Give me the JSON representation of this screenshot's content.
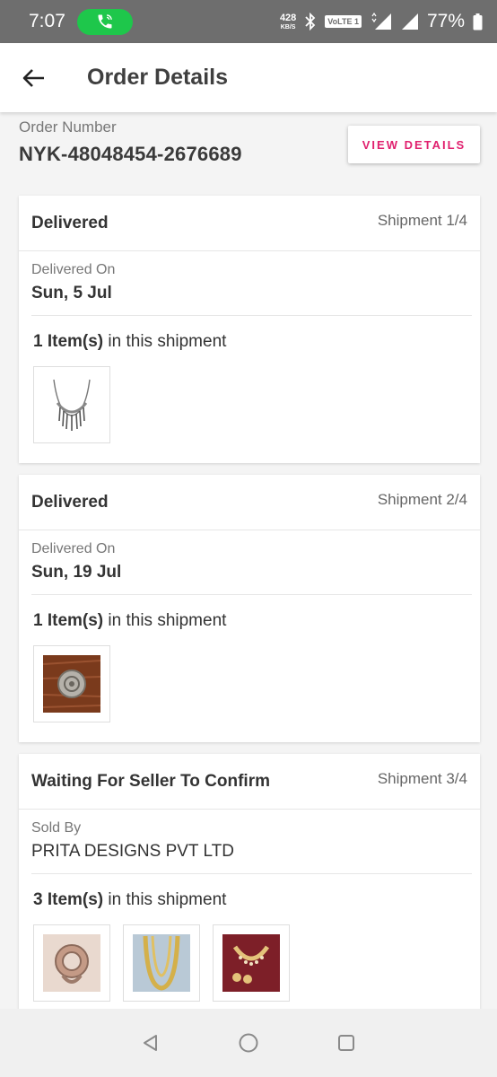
{
  "status_bar": {
    "time": "7:07",
    "net_speed": "428",
    "net_unit": "KB/S",
    "volte": "VoLTE 1",
    "battery": "77%",
    "call_color": "#1ec74b"
  },
  "header": {
    "title": "Order Details"
  },
  "order": {
    "label": "Order Number",
    "number": "NYK-48048454-2676689",
    "view_details": "VIEW DETAILS",
    "accent_color": "#e0206e"
  },
  "shipments": [
    {
      "status": "Delivered",
      "shipment": "Shipment 1/4",
      "info_label": "Delivered On",
      "info_value": "Sun, 5 Jul",
      "items_count": "1 Item(s)",
      "items_suffix": " in this shipment",
      "thumbs": [
        "silver-fringe-necklace"
      ]
    },
    {
      "status": "Delivered",
      "shipment": "Shipment 2/4",
      "info_label": "Delivered On",
      "info_value": "Sun, 19 Jul",
      "items_count": "1 Item(s)",
      "items_suffix": " in this shipment",
      "thumbs": [
        "oxidised-ring-on-wood"
      ]
    },
    {
      "status": "Waiting For Seller To Confirm",
      "shipment": "Shipment 3/4",
      "info_label": "Sold By",
      "info_value": "PRITA DESIGNS PVT LTD",
      "items_count": "3 Item(s)",
      "items_suffix": " in this shipment",
      "thumbs": [
        "floral-ring",
        "gold-long-necklace",
        "kundan-choker-set"
      ]
    }
  ],
  "nav": {
    "icons": [
      "back-triangle",
      "home-circle",
      "recents-square"
    ]
  }
}
